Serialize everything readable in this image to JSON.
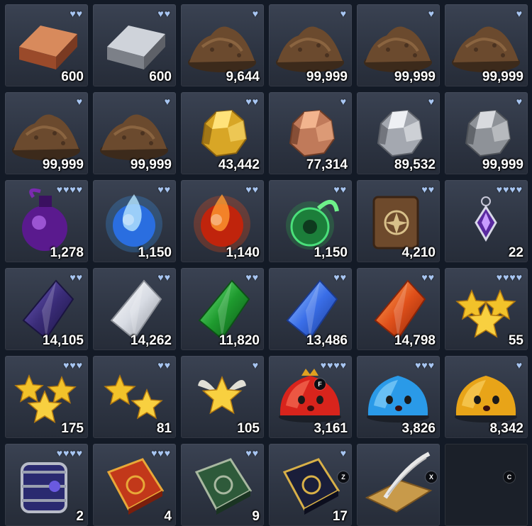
{
  "inventory": {
    "slots": [
      {
        "item": "copper-ingot",
        "hearts": 2,
        "qty": "600"
      },
      {
        "item": "silver-ingot",
        "hearts": 2,
        "qty": "600"
      },
      {
        "item": "dirt-pile",
        "hearts": 1,
        "qty": "9,644"
      },
      {
        "item": "dirt-pile",
        "hearts": 1,
        "qty": "99,999"
      },
      {
        "item": "dirt-pile",
        "hearts": 1,
        "qty": "99,999"
      },
      {
        "item": "dirt-pile",
        "hearts": 1,
        "qty": "99,999"
      },
      {
        "item": "dirt-pile",
        "hearts": 1,
        "qty": "99,999"
      },
      {
        "item": "dirt-pile",
        "hearts": 1,
        "qty": "99,999"
      },
      {
        "item": "gold-ore",
        "hearts": 2,
        "qty": "43,442"
      },
      {
        "item": "copper-ore",
        "hearts": 1,
        "qty": "77,314"
      },
      {
        "item": "silver-ore",
        "hearts": 1,
        "qty": "89,532"
      },
      {
        "item": "iron-ore",
        "hearts": 1,
        "qty": "99,999"
      },
      {
        "item": "purple-potion",
        "hearts": 4,
        "qty": "1,278"
      },
      {
        "item": "water-essence",
        "hearts": 2,
        "qty": "1,150"
      },
      {
        "item": "fire-essence",
        "hearts": 2,
        "qty": "1,140"
      },
      {
        "item": "nature-essence",
        "hearts": 2,
        "qty": "1,150"
      },
      {
        "item": "scroll",
        "hearts": 2,
        "qty": "4,210"
      },
      {
        "item": "amulet",
        "hearts": 4,
        "qty": "22"
      },
      {
        "item": "dark-crystal",
        "hearts": 2,
        "qty": "14,105"
      },
      {
        "item": "white-crystal",
        "hearts": 2,
        "qty": "14,262"
      },
      {
        "item": "green-crystal",
        "hearts": 2,
        "qty": "11,820"
      },
      {
        "item": "blue-crystal",
        "hearts": 2,
        "qty": "13,486"
      },
      {
        "item": "orange-crystal",
        "hearts": 2,
        "qty": "14,798"
      },
      {
        "item": "star-cluster",
        "hearts": 4,
        "qty": "55"
      },
      {
        "item": "triple-star",
        "hearts": 3,
        "qty": "175"
      },
      {
        "item": "double-star",
        "hearts": 2,
        "qty": "81"
      },
      {
        "item": "single-star",
        "hearts": 1,
        "qty": "105"
      },
      {
        "item": "red-slime",
        "hearts": 4,
        "qty": "3,161",
        "badge": "F"
      },
      {
        "item": "blue-slime",
        "hearts": 3,
        "qty": "3,826"
      },
      {
        "item": "yellow-slime",
        "hearts": 1,
        "qty": "8,342"
      },
      {
        "item": "armored-bag",
        "hearts": 4,
        "qty": "2"
      },
      {
        "item": "red-spellbook",
        "hearts": 3,
        "qty": "4"
      },
      {
        "item": "green-tome",
        "hearts": 2,
        "qty": "9"
      },
      {
        "item": "dark-tome",
        "hearts": 1,
        "qty": "17",
        "key": "Z"
      },
      {
        "item": "quill-parchment",
        "hearts": 0,
        "qty": "",
        "key": "X"
      },
      {
        "item": "empty-slot",
        "hearts": 0,
        "qty": "",
        "key": "C"
      }
    ]
  },
  "colors": {
    "background": "#131a26",
    "slot": "#2e3543",
    "heart": "#a8c6f2"
  }
}
